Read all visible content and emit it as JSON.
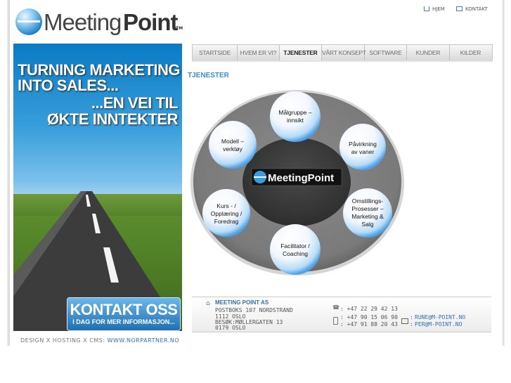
{
  "logo": {
    "word1": "Meeting",
    "word2": "Point",
    "tm": "TM"
  },
  "toplinks": [
    {
      "label": "HJEM",
      "icon": "home-icon"
    },
    {
      "label": "KONTAKT",
      "icon": "mail-icon"
    }
  ],
  "banner": {
    "headline1": "TURNING MARKETING",
    "headline2": "INTO SALES...",
    "headline3": "...EN VEI TIL",
    "headline4": "ØKTE INNTEKTER",
    "cta_big": "KONTAKT OSS",
    "cta_small": "I DAG FOR MER INFORMASJON..."
  },
  "credit": {
    "text": "DESIGN X HOSTING X CMS:",
    "link": "WWW.NORPARTNER.NO"
  },
  "nav": {
    "tabs": [
      {
        "label": "STARTSIDE",
        "active": false
      },
      {
        "label": "HVEM ER VI?",
        "active": false
      },
      {
        "label": "TJENESTER",
        "active": true
      },
      {
        "label": "VÅRT KONSEPT",
        "active": false
      },
      {
        "label": "SOFTWARE",
        "active": false
      },
      {
        "label": "KUNDER",
        "active": false
      },
      {
        "label": "KILDER",
        "active": false
      }
    ]
  },
  "page_title": "TJENESTER",
  "diagram": {
    "center_logo": "MeetingPoint",
    "nodes": [
      {
        "lines": [
          "Målgruppe –",
          "innsikt"
        ]
      },
      {
        "lines": [
          "Påvirkning",
          "av vaner"
        ]
      },
      {
        "lines": [
          "Omstillings-",
          "Prosesser –",
          "Marketing &",
          "Salg"
        ]
      },
      {
        "lines": [
          "Facilitator /",
          "Coaching"
        ]
      },
      {
        "lines": [
          "Kurs - /",
          "Opplæring /",
          "Foredrag"
        ]
      },
      {
        "lines": [
          "Modell –",
          "verktøy"
        ]
      }
    ]
  },
  "footer": {
    "company": "MEETING POINT AS",
    "address1": "POSTBOKS 107 NORDSTRAND",
    "address2": "1112 OSLO",
    "address3": "BESØK:MØLLERGATEN 13",
    "address4": "0179 OSLO",
    "phone": ": +47 22 29 42 13",
    "fax": ": +47 90 15 06 90",
    "mobile": ": +47 91 88 20 43",
    "email1": "RUNE@M-POINT.NO",
    "email2": "PER@M-POINT.NO"
  },
  "colors": {
    "accent": "#3b8ed2",
    "link": "#2f6fb5",
    "nav_bg": "#e0e0e0"
  }
}
